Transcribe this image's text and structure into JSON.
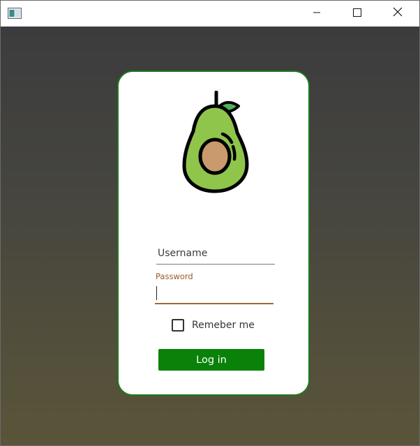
{
  "window": {
    "icon": "app-window-icon",
    "controls": [
      "minimize-icon",
      "maximize-icon",
      "close-icon"
    ]
  },
  "login": {
    "logo": "avocado-icon",
    "username_placeholder": "Username",
    "password_label": "Password",
    "password_value": "",
    "remember_label": "Remeber me",
    "remember_checked": false,
    "login_label": "Log in"
  },
  "colors": {
    "accent_green": "#0a820a",
    "card_border": "#1e7a1e",
    "password_accent": "#9a5a28"
  }
}
